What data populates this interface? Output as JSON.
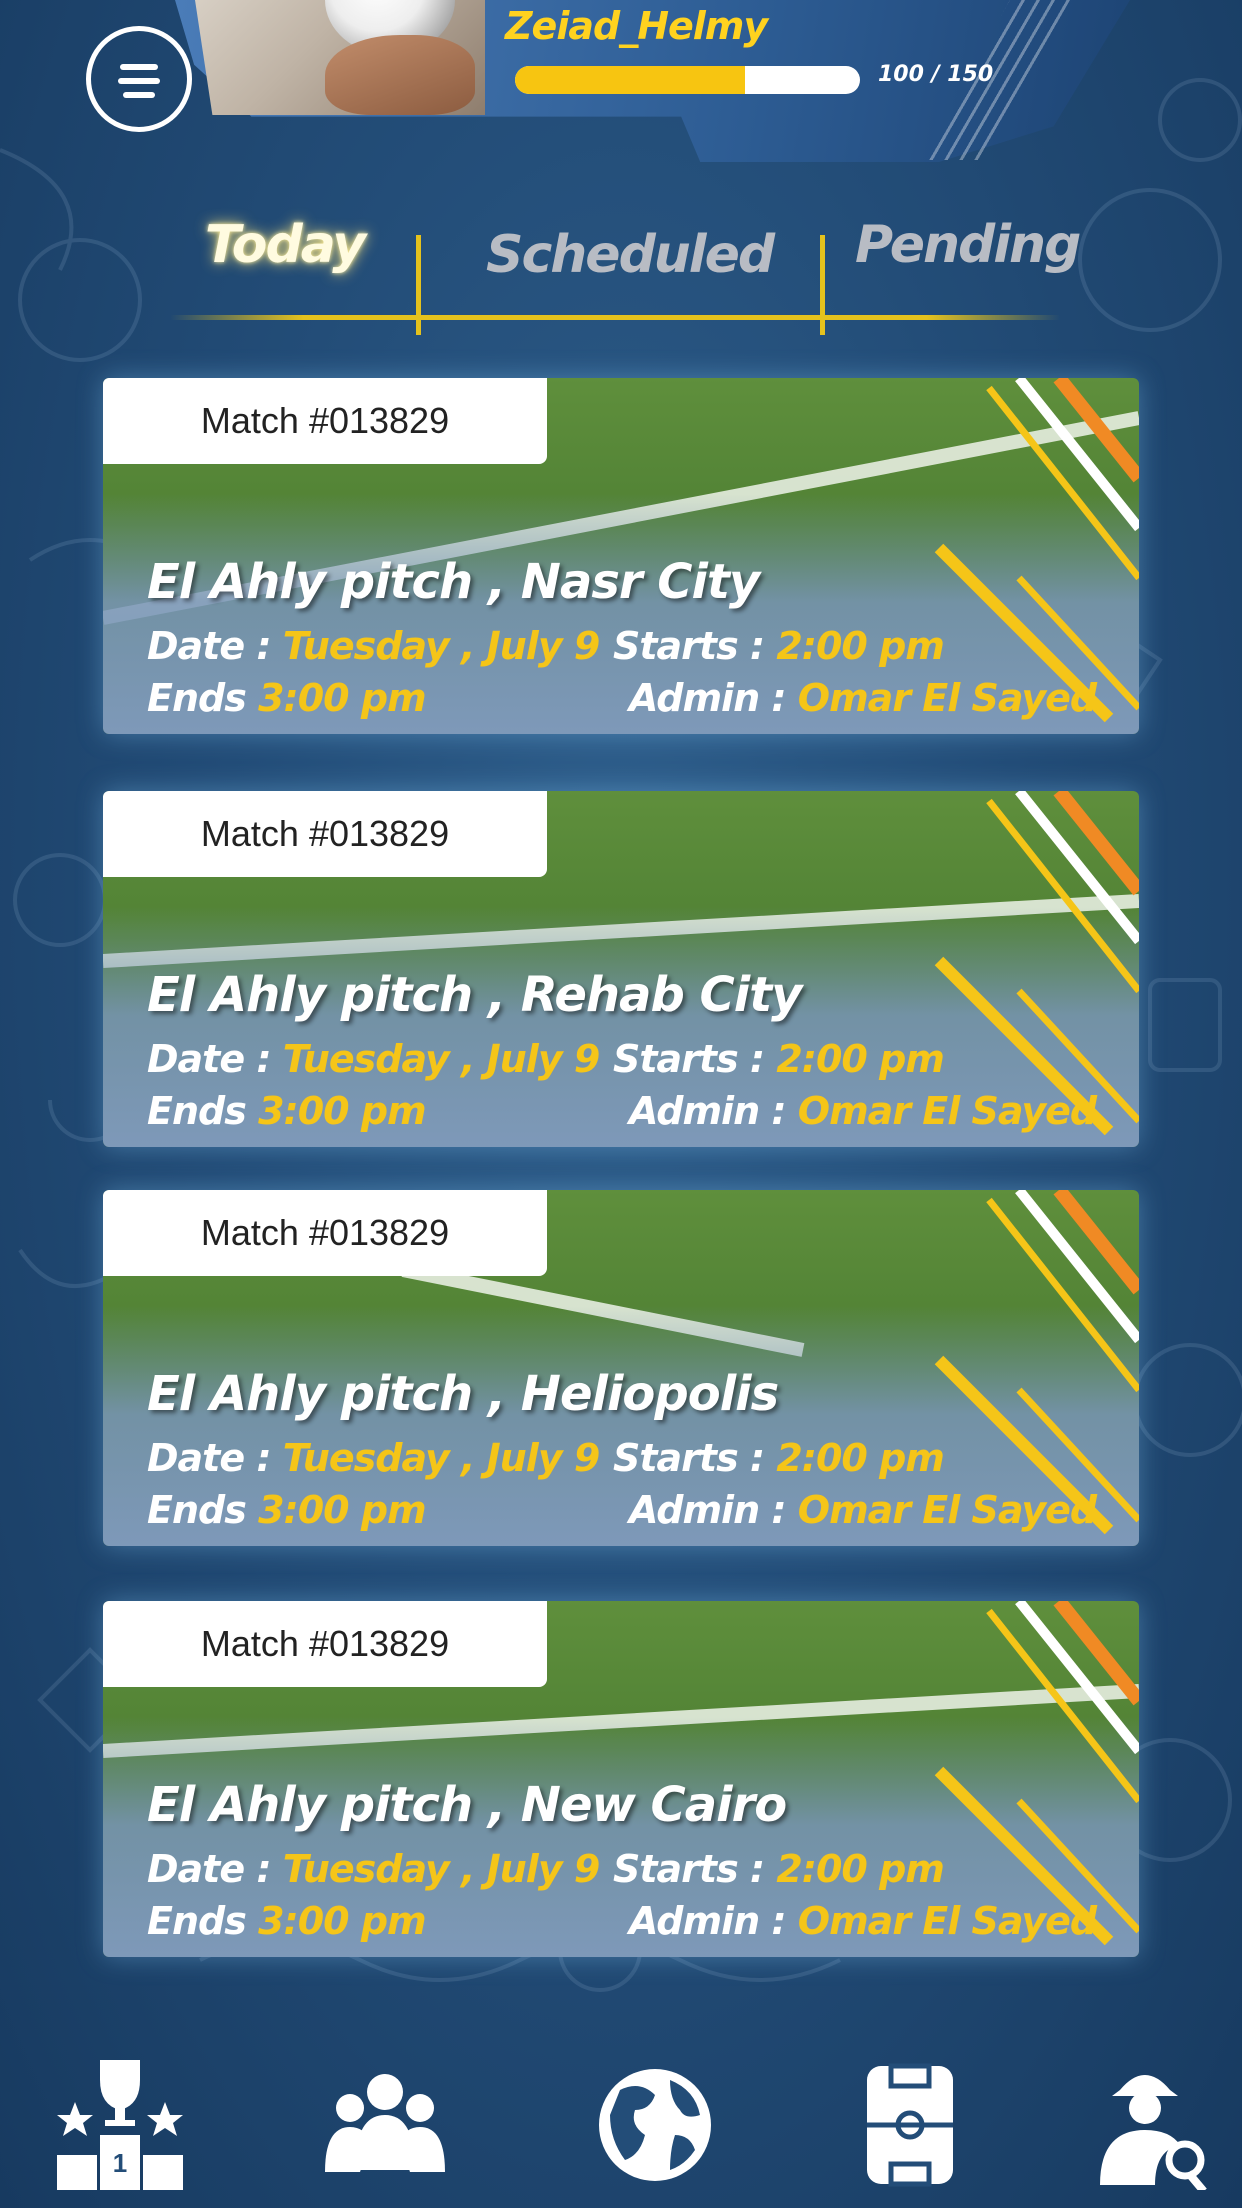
{
  "header": {
    "username": "Zeiad_Helmy",
    "xp_text": "100 / 150",
    "xp_progress": 0.667
  },
  "tabs": [
    {
      "label": "Today",
      "active": true
    },
    {
      "label": "Scheduled",
      "active": false
    },
    {
      "label": "Pending",
      "active": false
    }
  ],
  "labels": {
    "date": "Date :",
    "starts": "Starts :",
    "ends": "Ends",
    "admin": "Admin :"
  },
  "matches": [
    {
      "id": "Match #013829",
      "pitch": "El Ahly pitch , Nasr City",
      "date": "Tuesday , July 9",
      "starts": "2:00 pm",
      "ends": "3:00 pm",
      "admin": "Omar El Sayed"
    },
    {
      "id": "Match #013829",
      "pitch": "El Ahly pitch , Rehab City",
      "date": "Tuesday , July 9",
      "starts": "2:00 pm",
      "ends": "3:00 pm",
      "admin": "Omar El Sayed"
    },
    {
      "id": "Match #013829",
      "pitch": "El Ahly pitch , Heliopolis",
      "date": "Tuesday , July 9",
      "starts": "2:00 pm",
      "ends": "3:00 pm",
      "admin": "Omar El Sayed"
    },
    {
      "id": "Match #013829",
      "pitch": "El Ahly pitch , New Cairo",
      "date": "Tuesday , July 9",
      "starts": "2:00 pm",
      "ends": "3:00 pm",
      "admin": "Omar El Sayed"
    }
  ],
  "nav": [
    {
      "icon": "trophy-podium-icon"
    },
    {
      "icon": "team-icon"
    },
    {
      "icon": "globe-icon"
    },
    {
      "icon": "pitch-icon"
    },
    {
      "icon": "scout-search-icon"
    }
  ],
  "colors": {
    "accent": "#f5c518",
    "background": "#234d78"
  }
}
